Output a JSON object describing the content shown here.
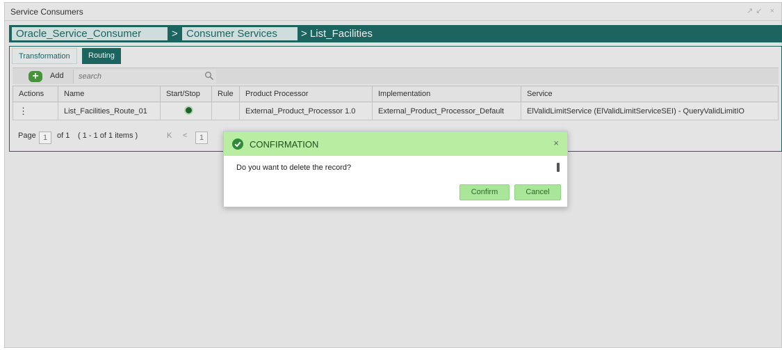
{
  "window": {
    "title": "Service Consumers",
    "controls": "↗↙ ×"
  },
  "breadcrumb": {
    "items": [
      "Oracle_Service_Consumer",
      "Consumer Services"
    ],
    "separator": ">",
    "current": "> List_Facilities"
  },
  "tabs": [
    {
      "label": "Transformation",
      "active": false
    },
    {
      "label": "Routing",
      "active": true
    }
  ],
  "toolbar": {
    "add_label": "Add",
    "search_placeholder": "search"
  },
  "table": {
    "columns": [
      "Actions",
      "Name",
      "Start/Stop",
      "Rule",
      "Product Processor",
      "Implementation",
      "Service"
    ],
    "rows": [
      {
        "actions": "⋮",
        "name": "List_Facilities_Route_01",
        "start_stop": "on",
        "rule": "",
        "product_processor": "External_Product_Processor 1.0",
        "implementation": "External_Product_Processor_Default",
        "service": "ElValidLimitService (ElValidLimitServiceSEI) - QueryValidLimitIO"
      }
    ]
  },
  "pager": {
    "page_label": "Page",
    "page_value": "1",
    "of_text": "of 1",
    "items_text": "( 1 - 1 of 1 items )",
    "first": "K",
    "prev": "<",
    "current": "1"
  },
  "dialog": {
    "title": "CONFIRMATION",
    "message": "Do you want to delete the record?",
    "confirm_label": "Confirm",
    "cancel_label": "Cancel",
    "close": "×"
  },
  "colors": {
    "accent": "#1d6b67",
    "dialog_header": "#b8eda2",
    "button": "#a9e69a"
  }
}
